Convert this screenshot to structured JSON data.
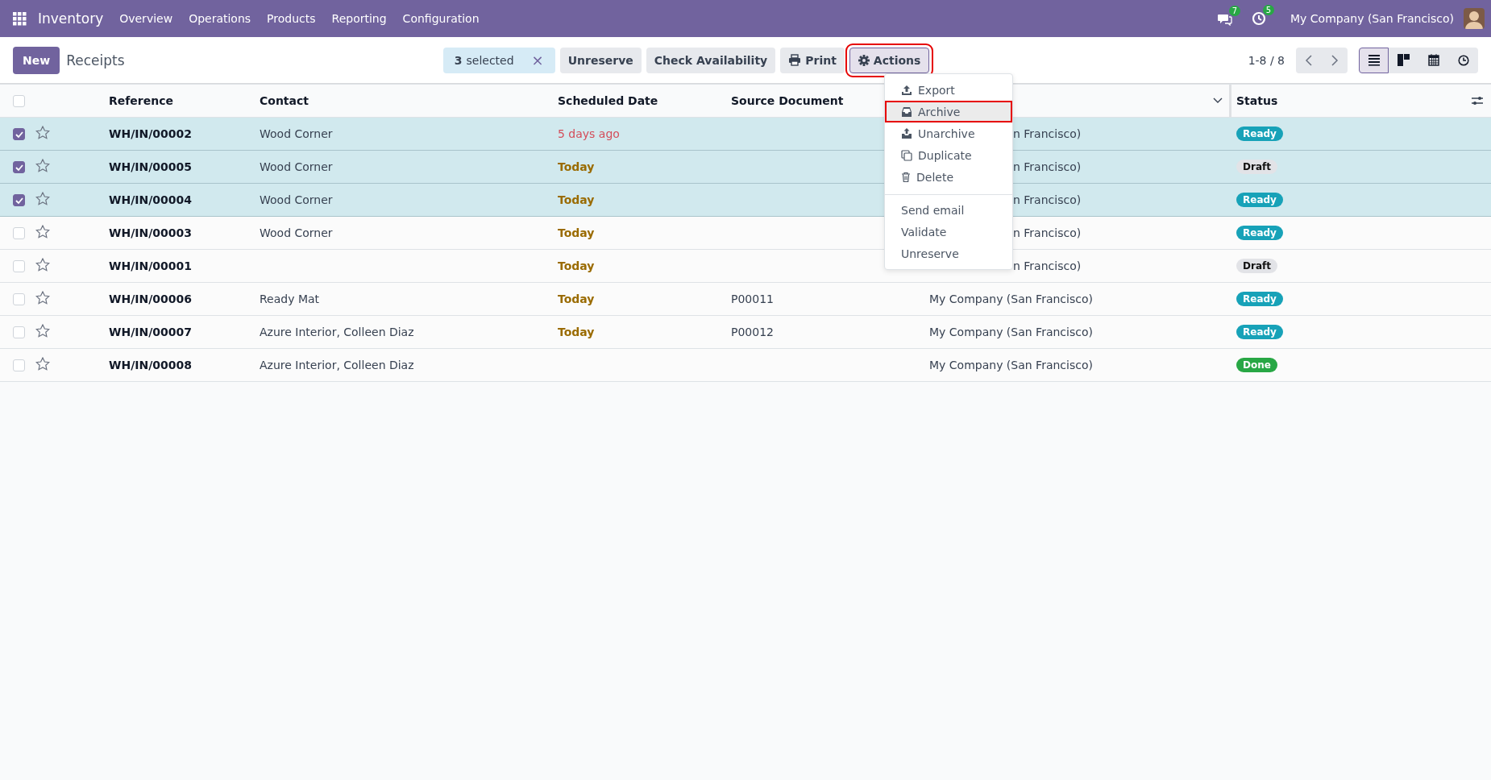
{
  "navbar": {
    "app_name": "Inventory",
    "menus": [
      "Overview",
      "Operations",
      "Products",
      "Reporting",
      "Configuration"
    ],
    "messages_count": "7",
    "activities_count": "5",
    "company": "My Company (San Francisco)"
  },
  "control_panel": {
    "new_button": "New",
    "breadcrumb": "Receipts",
    "selection": {
      "count": "3",
      "label": "selected",
      "clear": "×"
    },
    "actions": [
      {
        "label": "Unreserve",
        "kind": "plain",
        "highlighted": false
      },
      {
        "label": "Check Availability",
        "kind": "plain",
        "highlighted": false
      },
      {
        "label": "Print",
        "kind": "print",
        "highlighted": false
      },
      {
        "label": "Actions",
        "kind": "gear",
        "highlighted": true
      }
    ],
    "pager": "1-8 / 8",
    "views": [
      {
        "kind": "list",
        "selected": true
      },
      {
        "kind": "kanban",
        "selected": false
      },
      {
        "kind": "calendar",
        "selected": false
      },
      {
        "kind": "activity",
        "selected": false
      }
    ]
  },
  "table": {
    "select_all_checked": false,
    "columns": [
      "Reference",
      "Contact",
      "Scheduled Date",
      "Source Document",
      "Status"
    ],
    "rows": [
      {
        "selected": true,
        "reference": "WH/IN/00002",
        "contact": "Wood Corner",
        "scheduled_date": {
          "text": "5 days ago",
          "kind": "overdue"
        },
        "column_5": "n Francisco)",
        "status": {
          "text": "Ready",
          "kind": "ready"
        }
      },
      {
        "selected": true,
        "reference": "WH/IN/00005",
        "contact": "Wood Corner",
        "scheduled_date": {
          "text": "Today",
          "kind": "today"
        },
        "column_5": "n Francisco)",
        "status": {
          "text": "Draft",
          "kind": "draft"
        }
      },
      {
        "selected": true,
        "reference": "WH/IN/00004",
        "contact": "Wood Corner",
        "scheduled_date": {
          "text": "Today",
          "kind": "today"
        },
        "column_5": "n Francisco)",
        "status": {
          "text": "Ready",
          "kind": "ready"
        }
      },
      {
        "selected": false,
        "reference": "WH/IN/00003",
        "contact": "Wood Corner",
        "scheduled_date": {
          "text": "Today",
          "kind": "today"
        },
        "column_5": "n Francisco)",
        "status": {
          "text": "Ready",
          "kind": "ready"
        }
      },
      {
        "selected": false,
        "reference": "WH/IN/00001",
        "scheduled_date": {
          "text": "Today",
          "kind": "today"
        },
        "column_5": "n Francisco)",
        "status": {
          "text": "Draft",
          "kind": "draft"
        }
      },
      {
        "selected": false,
        "reference": "WH/IN/00006",
        "contact": "Ready Mat",
        "scheduled_date": {
          "text": "Today",
          "kind": "today"
        },
        "source_document": "P00011",
        "column_5": "My Company (San Francisco)",
        "status": {
          "text": "Ready",
          "kind": "ready"
        }
      },
      {
        "selected": false,
        "reference": "WH/IN/00007",
        "contact": "Azure Interior, Colleen Diaz",
        "scheduled_date": {
          "text": "Today",
          "kind": "today"
        },
        "source_document": "P00012",
        "column_5": "My Company (San Francisco)",
        "status": {
          "text": "Ready",
          "kind": "ready"
        }
      },
      {
        "selected": false,
        "reference": "WH/IN/00008",
        "contact": "Azure Interior, Colleen Diaz",
        "column_5": "My Company (San Francisco)",
        "status": {
          "text": "Done",
          "kind": "done"
        }
      }
    ]
  },
  "actions_menu": {
    "groups": [
      [
        {
          "label": "Export",
          "kind": "export",
          "highlighted": false
        },
        {
          "label": "Archive",
          "kind": "archive",
          "highlighted": true
        },
        {
          "label": "Unarchive",
          "kind": "unarchive",
          "highlighted": false
        },
        {
          "label": "Duplicate",
          "kind": "duplicate",
          "highlighted": false
        },
        {
          "label": "Delete",
          "kind": "delete",
          "highlighted": false
        }
      ],
      [
        {
          "label": "Send email",
          "kind": "plain",
          "highlighted": false
        },
        {
          "label": "Validate",
          "kind": "plain",
          "highlighted": false
        },
        {
          "label": "Unreserve",
          "kind": "plain",
          "highlighted": false
        }
      ]
    ]
  }
}
